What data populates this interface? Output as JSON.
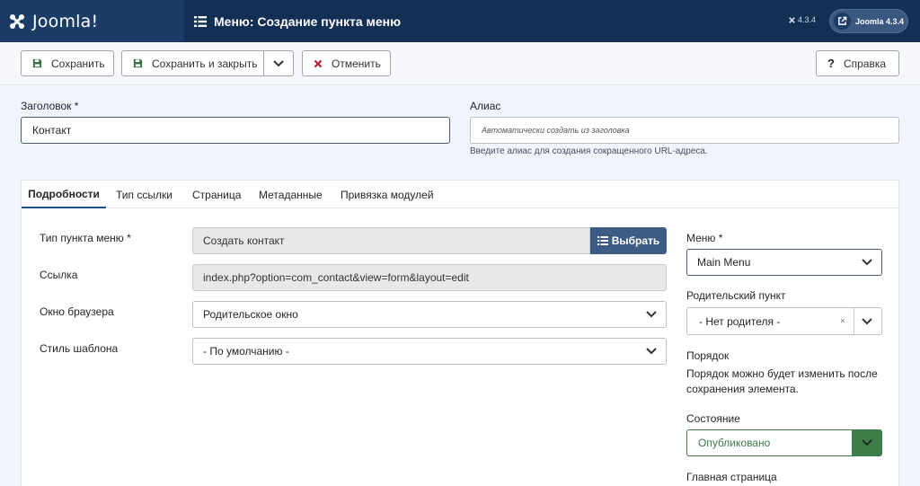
{
  "header": {
    "brand": "Joomla!",
    "page_title": "Меню: Создание пункта меню",
    "version_small": "4.3.4",
    "version_button": "Joomla 4.3.4"
  },
  "toolbar": {
    "save_label": "Сохранить",
    "save_close_label": "Сохранить и закрыть",
    "cancel_label": "Отменить",
    "help_label": "Справка"
  },
  "title_field": {
    "label": "Заголовок *",
    "value": "Контакт"
  },
  "alias_field": {
    "label": "Алиас",
    "placeholder": "Автоматически создать из заголовка",
    "hint": "Введите алиас для создания сокращенного URL-адреса."
  },
  "tabs": [
    {
      "label": "Подробности",
      "active": true
    },
    {
      "label": "Тип ссылки",
      "active": false
    },
    {
      "label": "Страница",
      "active": false
    },
    {
      "label": "Метаданные",
      "active": false
    },
    {
      "label": "Привязка модулей",
      "active": false
    }
  ],
  "details": {
    "item_type": {
      "label": "Тип пункта меню *",
      "value": "Создать контакт",
      "button": "Выбрать"
    },
    "link": {
      "label": "Ссылка",
      "value": "index.php?option=com_contact&view=form&layout=edit"
    },
    "browser_window": {
      "label": "Окно браузера",
      "value": "Родительское окно"
    },
    "template_style": {
      "label": "Стиль шаблона",
      "value": "- По умолчанию -"
    }
  },
  "sidebar": {
    "menu": {
      "label": "Меню *",
      "value": "Main Menu"
    },
    "parent": {
      "label": "Родительский пункт",
      "value": "- Нет родителя -",
      "clear": "×"
    },
    "order": {
      "label": "Порядок",
      "description": "Порядок можно будет изменить после сохранения элемента."
    },
    "state": {
      "label": "Состояние",
      "value": "Опубликовано"
    },
    "home": {
      "label": "Главная страница"
    }
  },
  "colors": {
    "header_bg": "#132f53",
    "brand_bg": "#1b3c66",
    "accent": "#3d5c85",
    "published": "#3e7f49"
  }
}
